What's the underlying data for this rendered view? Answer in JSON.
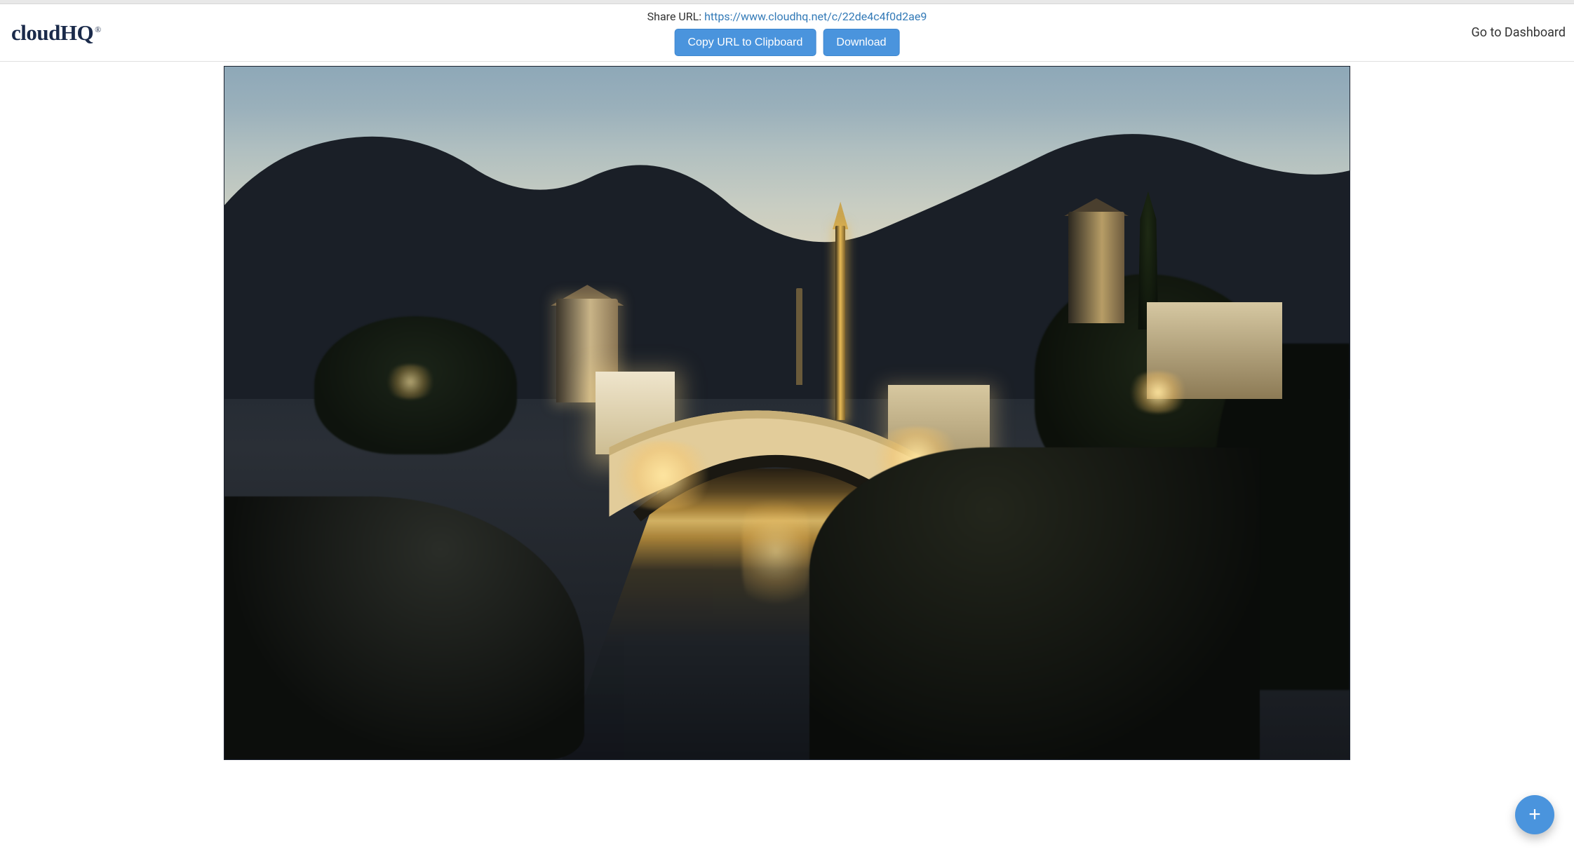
{
  "brand": {
    "name": "cloudHQ",
    "registered": "®"
  },
  "header": {
    "share_label": "Share URL: ",
    "share_url": "https://www.cloudhq.net/c/22de4c4f0d2ae9",
    "copy_button": "Copy URL to Clipboard",
    "download_button": "Download",
    "dashboard_link": "Go to Dashboard"
  },
  "fab": {
    "glyph": "+",
    "name": "add"
  }
}
